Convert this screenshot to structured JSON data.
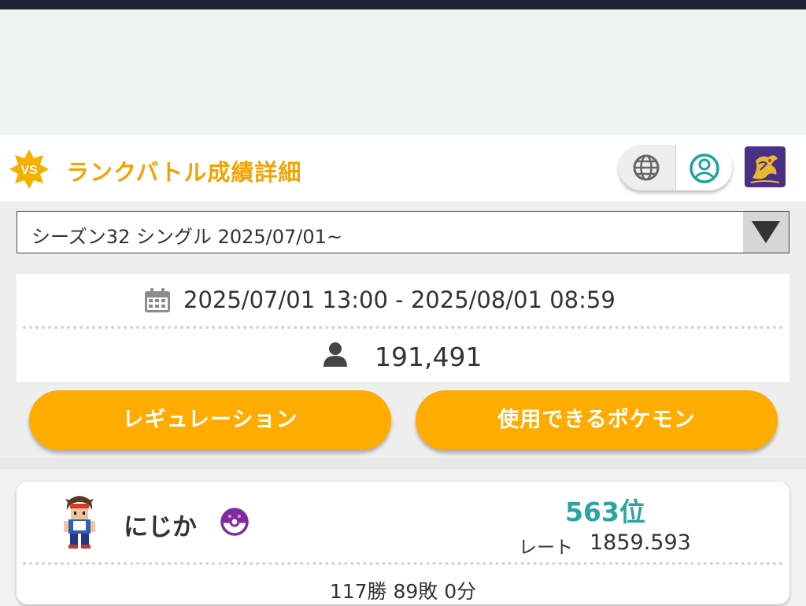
{
  "header": {
    "title": "ランクバトル成績詳細",
    "accent_color": "#f5a300",
    "vs_badge": "VS",
    "toggle": {
      "left_icon": "globe-icon",
      "right_icon": "user-circle-icon",
      "selected": "right"
    },
    "avatar_icon": "legendary-pokemon-icon"
  },
  "season_select": {
    "selected": "シーズン32 シングル 2025/07/01~"
  },
  "season_info": {
    "period": "2025/07/01 13:00 - 2025/08/01 08:59",
    "player_count": "191,491"
  },
  "buttons": {
    "regulation": "レギュレーション",
    "usable_pokemon": "使用できるポケモン",
    "color": "#ffab00"
  },
  "player": {
    "name": "にじか",
    "rank": "563位",
    "rate_label": "レート",
    "rate_value": "1859.593",
    "record": "117勝 89敗 0分",
    "rank_color": "#2aa5a0"
  }
}
